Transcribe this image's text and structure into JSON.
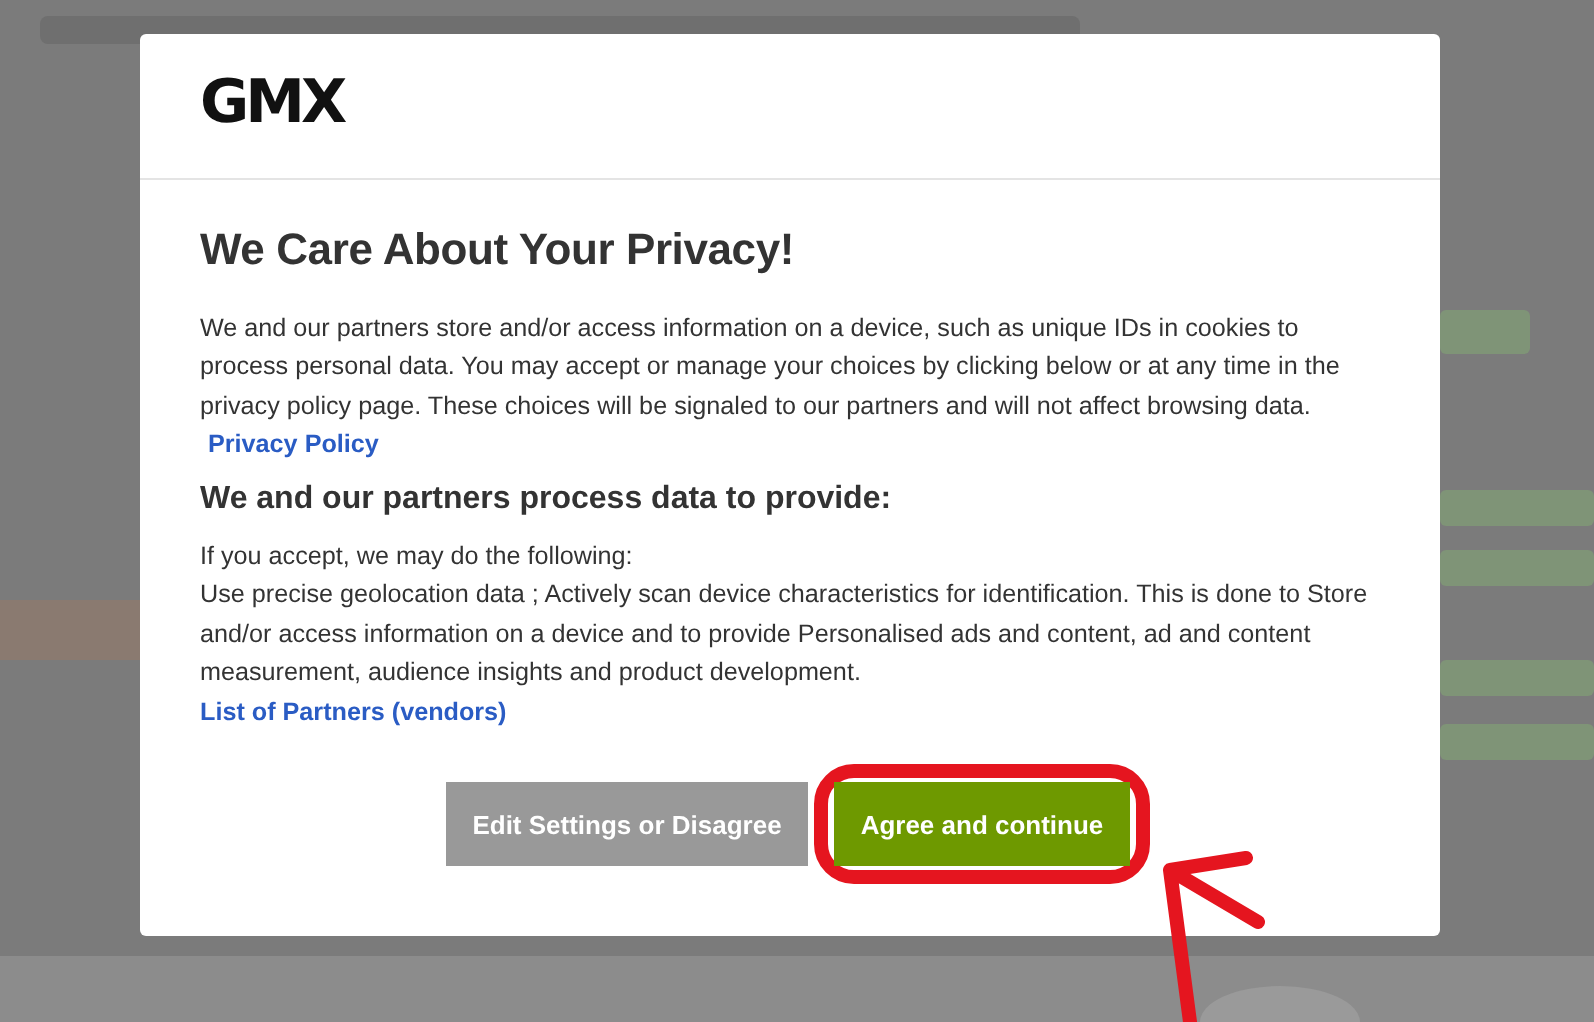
{
  "logo": "GMX",
  "title": "We Care About Your Privacy!",
  "intro": {
    "text": "We and our partners store and/or access information on a device, such as unique IDs in cookies to process personal data. You may accept or manage your choices by clicking below or at any time in the privacy policy page. These choices will be signaled to our partners and will not affect browsing data.",
    "link": "Privacy Policy"
  },
  "subheading": "We and our partners process data to provide:",
  "purposes": [
    "If you accept, we may do the following:",
    "Use precise geolocation data ; Actively scan device characteristics for identification. This is done to Store and/or access information on a device and to provide Personalised ads and content, ad and content measurement, audience insights and product development."
  ],
  "vendors_link": "List of Partners (vendors)",
  "buttons": [
    {
      "label": "Edit Settings or Disagree",
      "kind": "secondary",
      "highlighted": false
    },
    {
      "label": "Agree and continue",
      "kind": "primary",
      "highlighted": true
    }
  ]
}
